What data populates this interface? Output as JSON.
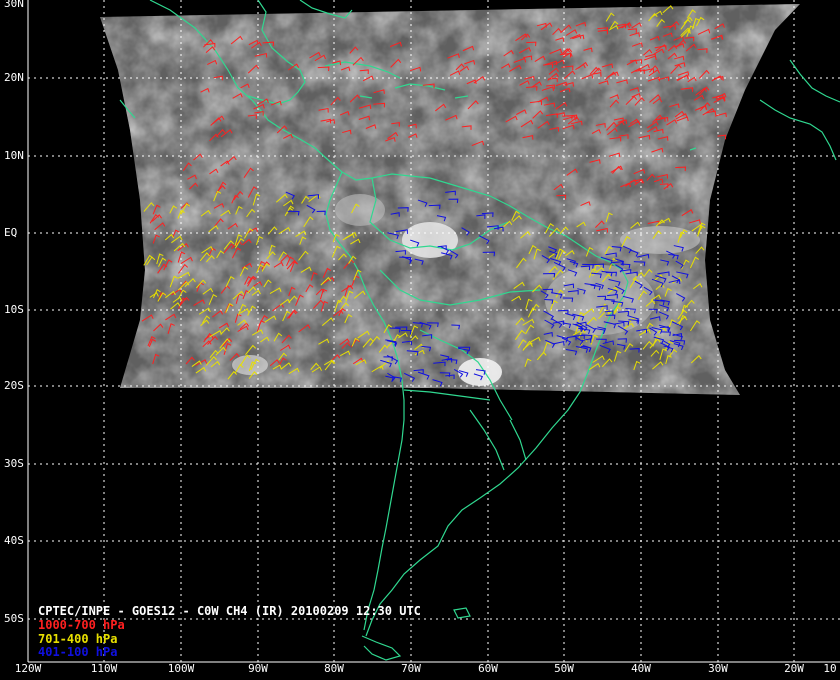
{
  "title": "CPTEC/INPE - GOES12 - C0W CH4 (IR) 20100209 12:30 UTC",
  "legend": [
    {
      "label": "1000-700 hPa",
      "color": "#ff2020"
    },
    {
      "label": "701-400 hPa",
      "color": "#e8e000"
    },
    {
      "label": "401-100 hPa",
      "color": "#1010e0"
    }
  ],
  "lat_labels": [
    "30N",
    "20N",
    "10N",
    "EQ",
    "10S",
    "20S",
    "30S",
    "40S",
    "50S"
  ],
  "lon_labels": [
    "120W",
    "110W",
    "100W",
    "90W",
    "80W",
    "70W",
    "60W",
    "50W",
    "40W",
    "30W",
    "20W",
    "10"
  ],
  "colors": {
    "background": "#000000",
    "coastline": "#30d890",
    "grid": "#ffffff",
    "satellite_image": "#6a6a6a"
  }
}
